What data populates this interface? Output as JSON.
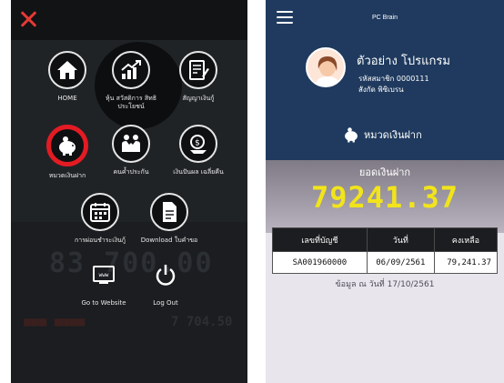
{
  "menu_screen": {
    "close_icon": "close-x-icon",
    "items": [
      {
        "label": "HOME",
        "icon": "home-icon"
      },
      {
        "label": "หุ้น สวัสดิการ สิทธิประโยชน์",
        "icon": "growth-chart-icon"
      },
      {
        "label": "สัญญาเงินกู้",
        "icon": "contract-icon"
      },
      {
        "label": "หมวดเงินฝาก",
        "icon": "piggy-bank-icon",
        "active": true
      },
      {
        "label": "คนค้ำประกัน",
        "icon": "guarantor-icon"
      },
      {
        "label": "เงินปันผล เฉลี่ยคืน",
        "icon": "dividend-icon"
      },
      {
        "label": "การผ่อนชำระเงินกู้",
        "icon": "calendar-icon"
      },
      {
        "label": "Download ใบคำขอ",
        "icon": "document-icon"
      },
      {
        "label": "Go to Website",
        "icon": "website-icon"
      },
      {
        "label": "Log Out",
        "icon": "power-icon"
      }
    ],
    "active_color": "#e31b23"
  },
  "account_screen": {
    "app_title": "PC Brain",
    "profile": {
      "name": "ตัวอย่าง โปรแกรม",
      "member_id": "รหัสสมาชิก 0000111",
      "branch": "สังกัด พิซิเบรน"
    },
    "section": {
      "label": "หมวดเงินฝาก",
      "icon": "piggy-bank-icon"
    },
    "balance_label": "ยอดเงินฝาก",
    "balance": "79241.37",
    "table": {
      "headers": [
        "เลขที่บัญชี",
        "วันที่",
        "คงเหลือ"
      ],
      "rows": [
        {
          "account": "SA001960000",
          "date": "06/09/2561",
          "remaining": "79,241.37"
        }
      ]
    },
    "data_as_of": "ข้อมูล ณ วันที่ 17/10/2561",
    "colors": {
      "header": "#1f3a5e",
      "balance": "#f2e41a",
      "table_header": "#1b1d20"
    }
  }
}
